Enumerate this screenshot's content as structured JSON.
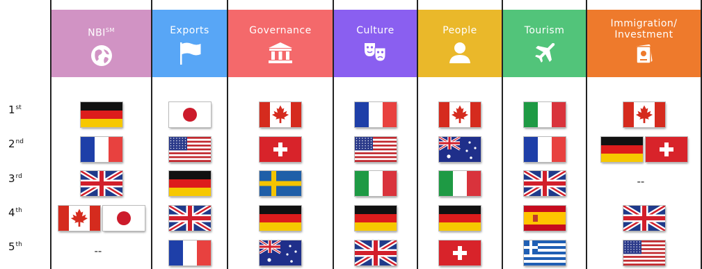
{
  "columns": [
    {
      "key": "nbi",
      "label": "NBI",
      "label_sup": "SM",
      "color": "#d193c4",
      "icon": "globe-icon"
    },
    {
      "key": "exports",
      "label": "Exports",
      "color": "#58a6f6",
      "icon": "flag-icon"
    },
    {
      "key": "governance",
      "label": "Governance",
      "color": "#f4696b",
      "icon": "government-building-icon"
    },
    {
      "key": "culture",
      "label": "Culture",
      "color": "#8a5ff0",
      "icon": "theater-masks-icon"
    },
    {
      "key": "people",
      "label": "People",
      "color": "#eab82a",
      "icon": "person-icon"
    },
    {
      "key": "tourism",
      "label": "Tourism",
      "color": "#52c47a",
      "icon": "airplane-icon"
    },
    {
      "key": "immigration",
      "label": "Immigration/ Investment",
      "color": "#ee7a2c",
      "icon": "passport-icon"
    }
  ],
  "ranks": [
    {
      "num": "1",
      "suffix": "st"
    },
    {
      "num": "2",
      "suffix": "nd"
    },
    {
      "num": "3",
      "suffix": "rd"
    },
    {
      "num": "4",
      "suffix": "th"
    },
    {
      "num": "5",
      "suffix": "th"
    }
  ],
  "placeholder": "--",
  "rankings": {
    "nbi": [
      [
        "germany"
      ],
      [
        "france"
      ],
      [
        "united-kingdom"
      ],
      [
        "canada",
        "japan"
      ],
      []
    ],
    "exports": [
      [
        "japan"
      ],
      [
        "united-states"
      ],
      [
        "germany"
      ],
      [
        "united-kingdom"
      ],
      [
        "france"
      ]
    ],
    "governance": [
      [
        "canada"
      ],
      [
        "switzerland"
      ],
      [
        "sweden"
      ],
      [
        "germany"
      ],
      [
        "australia"
      ]
    ],
    "culture": [
      [
        "france"
      ],
      [
        "united-states"
      ],
      [
        "italy"
      ],
      [
        "germany"
      ],
      [
        "united-kingdom"
      ]
    ],
    "people": [
      [
        "canada"
      ],
      [
        "australia"
      ],
      [
        "italy"
      ],
      [
        "germany"
      ],
      [
        "switzerland"
      ]
    ],
    "tourism": [
      [
        "italy"
      ],
      [
        "france"
      ],
      [
        "united-kingdom"
      ],
      [
        "spain"
      ],
      [
        "greece"
      ]
    ],
    "immigration": [
      [
        "canada"
      ],
      [
        "germany",
        "switzerland"
      ],
      [],
      [
        "united-kingdom"
      ],
      [
        "united-states"
      ]
    ]
  }
}
